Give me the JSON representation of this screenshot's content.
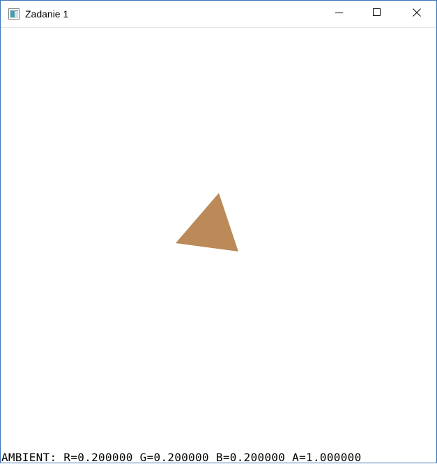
{
  "window": {
    "title": "Zadanie 1",
    "icons": {
      "app": "app-window-icon",
      "minimize": "minimize-icon",
      "maximize": "maximize-icon",
      "close": "close-icon"
    },
    "colors": {
      "border": "#3c73b5",
      "titlebar": "#ffffff"
    }
  },
  "viewport": {
    "background": "#ffffff",
    "triangle_color": "#bb8a58",
    "status_text": "AMBIENT: R=0.200000 G=0.200000 B=0.200000 A=1.000000"
  }
}
